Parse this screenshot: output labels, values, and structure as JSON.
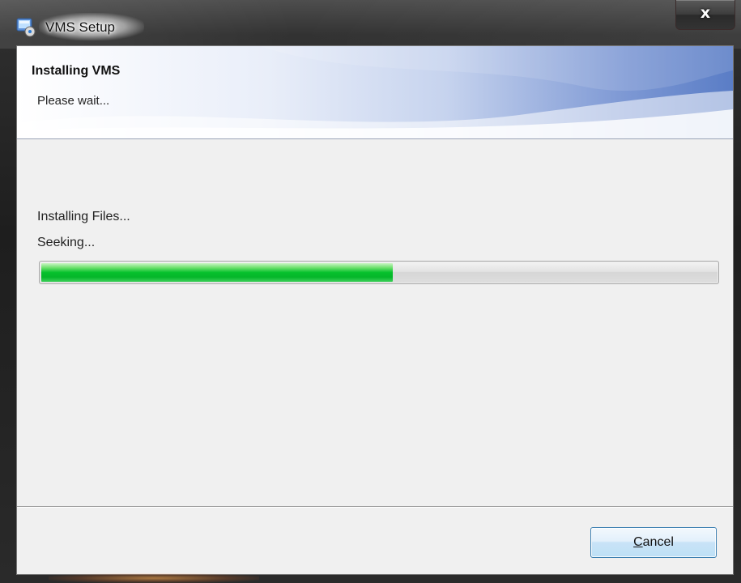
{
  "window": {
    "title": "VMS Setup",
    "close_symbol": "x"
  },
  "banner": {
    "title": "Installing VMS",
    "subtitle": "Please wait..."
  },
  "status": {
    "line1": "Installing Files...",
    "line2": "Seeking..."
  },
  "progress": {
    "value_percent": 52,
    "fill_color": "#06c12d"
  },
  "footer": {
    "cancel_label_accel": "C",
    "cancel_label_rest": "ancel"
  },
  "icons": {
    "app_icon": "installer-app-icon",
    "close_icon": "close-icon"
  }
}
